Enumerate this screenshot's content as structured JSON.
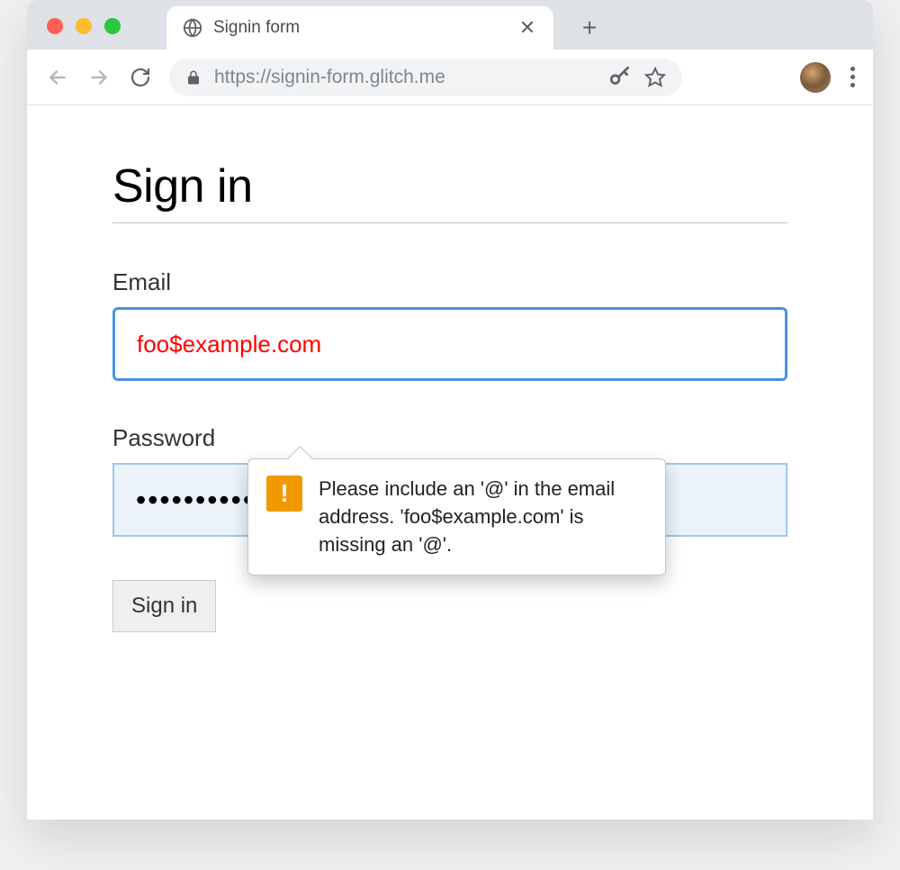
{
  "browser": {
    "tab_title": "Signin form",
    "url": "https://signin-form.glitch.me"
  },
  "page": {
    "heading": "Sign in",
    "email_label": "Email",
    "email_value": "foo$example.com",
    "password_label": "Password",
    "password_value": "••••••••••",
    "submit_label": "Sign in"
  },
  "tooltip": {
    "message": "Please include an '@' in the email address. 'foo$example.com' is missing an '@'."
  }
}
